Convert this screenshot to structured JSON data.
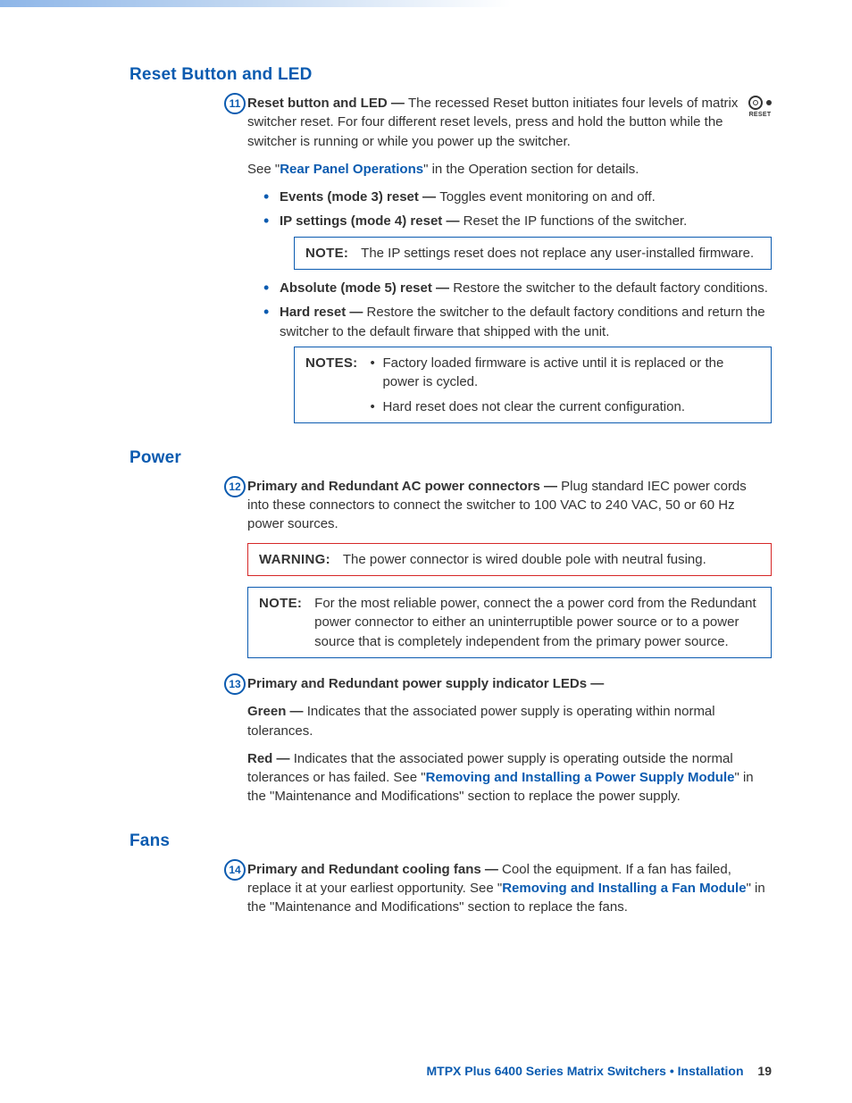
{
  "sections": {
    "reset": {
      "heading": "Reset Button and LED",
      "callout_num": "11",
      "lead_bold": "Reset button and LED — ",
      "lead_text": "The recessed Reset button initiates four levels of matrix switcher reset. For four different reset levels, press and hold the button while the switcher is running or while you power up the switcher.",
      "see_pre": "See \"",
      "see_link": "Rear Panel Operations",
      "see_post": "\" in the Operation section for details.",
      "bullets": {
        "b1_bold": "Events (mode 3) reset — ",
        "b1_text": "Toggles event monitoring on and off.",
        "b2_bold": "IP settings (mode 4) reset — ",
        "b2_text": "Reset the IP functions of the switcher.",
        "note1_label": "NOTE:",
        "note1_text": "The IP settings reset does not replace any user-installed firmware.",
        "b3_bold": "Absolute (mode 5) reset — ",
        "b3_text": "Restore the switcher to the default factory conditions.",
        "b4_bold": "Hard reset — ",
        "b4_text": "Restore the switcher to the default factory conditions and return the switcher to the default firware that shipped with the unit.",
        "notes2_label": "NOTES:",
        "notes2_a": "Factory loaded firmware is active until it is replaced or the power is cycled.",
        "notes2_b": "Hard reset does not clear the current configuration."
      },
      "reset_icon_label": "RESET"
    },
    "power": {
      "heading": "Power",
      "item12": {
        "num": "12",
        "bold": "Primary and Redundant AC power connectors — ",
        "text": "Plug standard IEC power cords into these connectors to connect the switcher to 100 VAC to 240 VAC, 50 or 60 Hz power sources.",
        "warn_label": "WARNING:",
        "warn_text": "The power connector is wired double pole with neutral fusing.",
        "note_label": "NOTE:",
        "note_text": "For the most reliable power, connect the a power cord from the Redundant power connector to either an uninterruptible power source or to a power source that is completely independent from the primary power source."
      },
      "item13": {
        "num": "13",
        "bold": "Primary and Redundant power supply indicator LEDs —",
        "green_bold": "Green — ",
        "green_text": "Indicates that the associated power supply is operating within normal tolerances.",
        "red_bold": "Red — ",
        "red_pre": "Indicates that the associated power supply is operating outside the normal tolerances or has failed. See \"",
        "red_link": "Removing and Installing a Power Supply Module",
        "red_post": "\" in the \"Maintenance and Modifications\" section to replace the power supply."
      }
    },
    "fans": {
      "heading": "Fans",
      "item14": {
        "num": "14",
        "bold": "Primary and Redundant cooling fans — ",
        "pre": "Cool the equipment. If a fan has failed, replace it at your earliest opportunity. See \"",
        "link": "Removing and Installing a Fan Module",
        "post": "\" in the \"Maintenance and Modifications\" section to replace the fans."
      }
    }
  },
  "footer": {
    "title": "MTPX Plus 6400 Series Matrix Switchers • Installation",
    "page": "19"
  }
}
